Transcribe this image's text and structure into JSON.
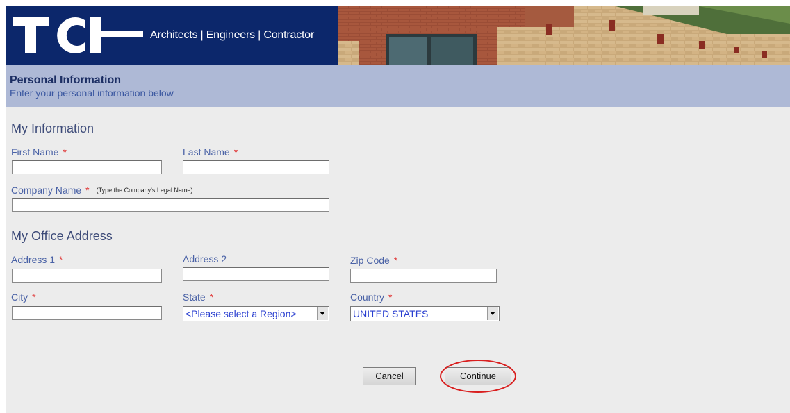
{
  "header": {
    "logo_text": "TCI",
    "tagline": "Architects | Engineers | Contractor"
  },
  "page_header": {
    "title": "Personal Information",
    "subtitle": "Enter your personal information below"
  },
  "my_information": {
    "title": "My Information",
    "first_name": {
      "label": "First Name",
      "required": "*",
      "value": ""
    },
    "last_name": {
      "label": "Last Name",
      "required": "*",
      "value": ""
    },
    "company_name": {
      "label": "Company Name",
      "required": "*",
      "hint": "(Type the Company's Legal Name)",
      "value": ""
    }
  },
  "office_address": {
    "title": "My Office Address",
    "address1": {
      "label": "Address 1",
      "required": "*",
      "value": ""
    },
    "address2": {
      "label": "Address 2",
      "value": ""
    },
    "zip": {
      "label": "Zip Code",
      "required": "*",
      "value": ""
    },
    "city": {
      "label": "City",
      "required": "*",
      "value": ""
    },
    "state": {
      "label": "State",
      "required": "*",
      "selected": "<Please select a Region>"
    },
    "country": {
      "label": "Country",
      "required": "*",
      "selected": "UNITED STATES"
    }
  },
  "actions": {
    "cancel_label": "Cancel",
    "continue_label": "Continue"
  },
  "colors": {
    "banner": "#0e2a6d",
    "band": "#aeb9d6",
    "label": "#4a62a6",
    "required": "#e03b3b",
    "highlight_ring": "#d91f1f"
  }
}
